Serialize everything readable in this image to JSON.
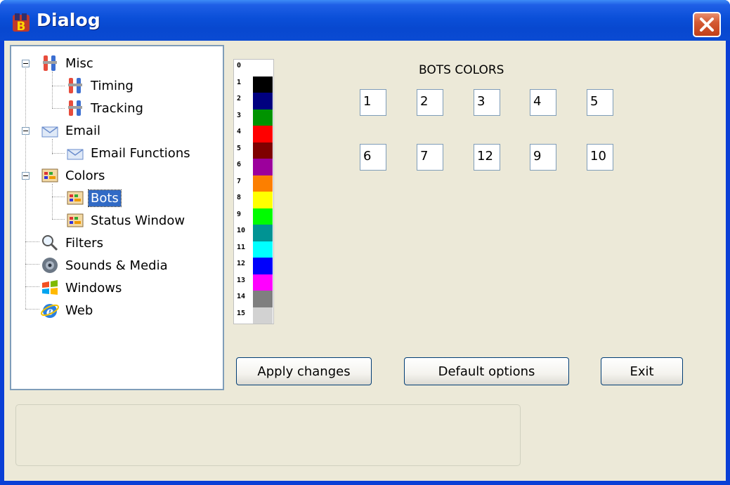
{
  "window": {
    "title": "Dialog",
    "icon": "app-icon",
    "close_icon": "close-icon"
  },
  "tree": {
    "items": [
      {
        "label": "Misc",
        "icon": "wrench-icon",
        "expanded": true
      },
      {
        "label": "Timing",
        "icon": "wrench-icon"
      },
      {
        "label": "Tracking",
        "icon": "wrench-icon"
      },
      {
        "label": "Email",
        "icon": "envelope-icon",
        "expanded": true
      },
      {
        "label": "Email Functions",
        "icon": "envelope-icon"
      },
      {
        "label": "Colors",
        "icon": "palette-icon",
        "expanded": true
      },
      {
        "label": "Bots",
        "icon": "palette-icon",
        "selected": true
      },
      {
        "label": "Status Window",
        "icon": "palette-icon"
      },
      {
        "label": "Filters",
        "icon": "magnifier-icon"
      },
      {
        "label": "Sounds & Media",
        "icon": "speaker-icon"
      },
      {
        "label": "Windows",
        "icon": "windows-flag-icon"
      },
      {
        "label": "Web",
        "icon": "internet-explorer-icon"
      }
    ]
  },
  "palette": {
    "numbers": [
      "0",
      "1",
      "2",
      "3",
      "4",
      "5",
      "6",
      "7",
      "8",
      "9",
      "10",
      "11",
      "12",
      "13",
      "14",
      "15"
    ],
    "colors": [
      "#ffffff",
      "#000000",
      "#00007f",
      "#009300",
      "#ff0000",
      "#7f0000",
      "#9c009c",
      "#fc7f00",
      "#ffff00",
      "#00fc00",
      "#009393",
      "#00ffff",
      "#0000fc",
      "#ff00ff",
      "#7f7f7f",
      "#d2d2d2"
    ]
  },
  "bots_colors": {
    "heading": "BOTS COLORS",
    "values": [
      "1",
      "2",
      "3",
      "4",
      "5",
      "6",
      "7",
      "12",
      "9",
      "10"
    ]
  },
  "buttons": {
    "apply": "Apply changes",
    "default": "Default options",
    "exit": "Exit"
  }
}
